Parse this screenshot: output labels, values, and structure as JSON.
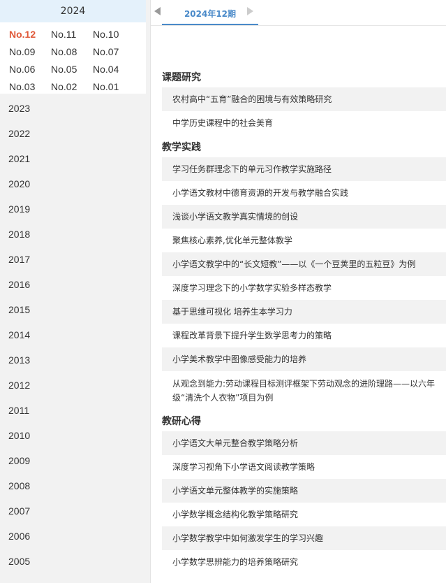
{
  "sidebar": {
    "current_year": "2024",
    "issues": [
      [
        "No.12",
        "No.11",
        "No.10"
      ],
      [
        "No.09",
        "No.08",
        "No.07"
      ],
      [
        "No.06",
        "No.05",
        "No.04"
      ],
      [
        "No.03",
        "No.02",
        "No.01"
      ]
    ],
    "active_issue": "No.12",
    "years": [
      "2023",
      "2022",
      "2021",
      "2020",
      "2019",
      "2018",
      "2017",
      "2016",
      "2015",
      "2014",
      "2013",
      "2012",
      "2011",
      "2010",
      "2009",
      "2008",
      "2007",
      "2006",
      "2005"
    ]
  },
  "month_nav": {
    "label": "2024年12期"
  },
  "sections": [
    {
      "title": "课题研究",
      "articles": [
        "农村高中“五育”融合的困境与有效策略研究",
        "中学历史课程中的社会美育"
      ]
    },
    {
      "title": "教学实践",
      "articles": [
        "学习任务群理念下的单元习作教学实施路径",
        "小学语文教材中德育资源的开发与教学融合实践",
        "浅谈小学语文教学真实情境的创设",
        "聚焦核心素养,优化单元整体教学",
        "小学语文教学中的“长文短教”——以《一个豆荚里的五粒豆》为例",
        "深度学习理念下的小学数学实验多样态教学",
        "基于思维可视化 培养生本学习力",
        "课程改革背景下提升学生数学思考力的策略",
        "小学美术教学中图像感受能力的培养",
        "从观念到能力:劳动课程目标测评框架下劳动观念的进阶理路——以六年级“清洗个人衣物”项目为例"
      ]
    },
    {
      "title": "教研心得",
      "articles": [
        "小学语文大单元整合教学策略分析",
        "深度学习视角下小学语文阅读教学策略",
        "小学语文单元整体教学的实施策略",
        "小学数学概念结构化教学策略研究",
        "小学数学教学中如何激发学生的学习兴趣",
        "小学数学思辨能力的培养策略研究"
      ]
    }
  ]
}
